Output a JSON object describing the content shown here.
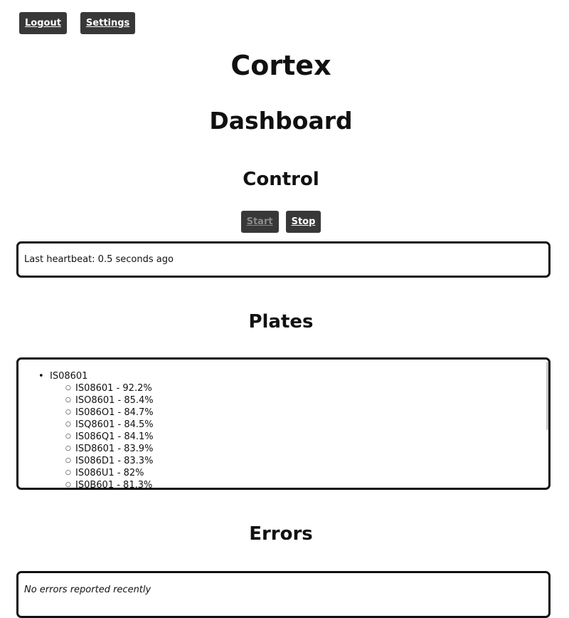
{
  "nav": {
    "logout_label": "Logout",
    "settings_label": "Settings"
  },
  "header": {
    "app_title": "Cortex",
    "page_title": "Dashboard"
  },
  "control": {
    "heading": "Control",
    "start_label": "Start",
    "stop_label": "Stop",
    "heartbeat": "Last heartbeat: 0.5 seconds ago"
  },
  "plates": {
    "heading": "Plates",
    "groups": [
      {
        "name": "IS08601",
        "items": [
          "IS08601 - 92.2%",
          "ISO8601 - 85.4%",
          "IS086O1 - 84.7%",
          "ISQ8601 - 84.5%",
          "IS086Q1 - 84.1%",
          "ISD8601 - 83.9%",
          "IS086D1 - 83.3%",
          "IS086U1 - 82%",
          "IS0B601 - 81.3%"
        ]
      }
    ]
  },
  "errors": {
    "heading": "Errors",
    "message": "No errors reported recently"
  }
}
